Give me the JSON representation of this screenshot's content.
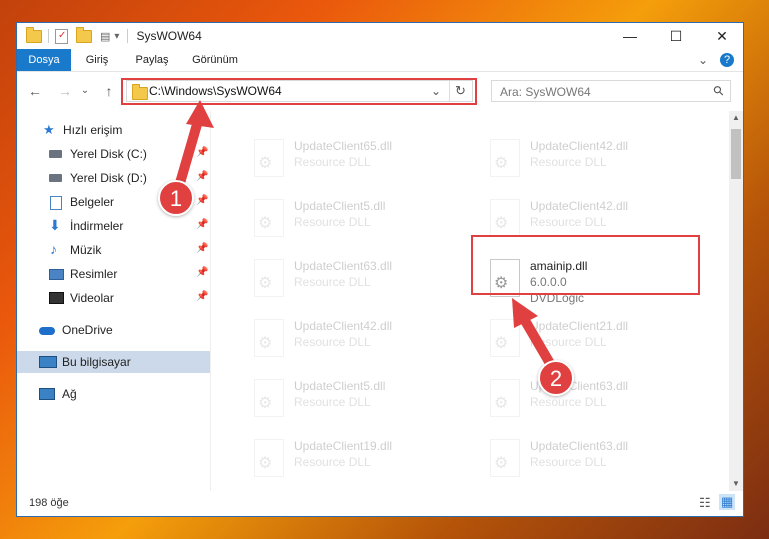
{
  "window": {
    "title": "SysWOW64",
    "qa_chevron": "▾"
  },
  "ribbon": {
    "tabs": [
      {
        "label": "Dosya",
        "active": true
      },
      {
        "label": "Giriş",
        "active": false
      },
      {
        "label": "Paylaş",
        "active": false
      },
      {
        "label": "Görünüm",
        "active": false
      }
    ],
    "help": "?"
  },
  "controls": {
    "minimize": "—",
    "maximize": "☐",
    "close": "✕",
    "ribbon_toggle": "⌄"
  },
  "address": {
    "path": "C:\\Windows\\SysWOW64",
    "dropdown": "⌄",
    "refresh": "↻"
  },
  "search": {
    "placeholder": "Ara: SysWOW64",
    "icon": "⚲"
  },
  "nav_buttons": {
    "back": "←",
    "forward": "→",
    "recent": "⌄",
    "up": "↑"
  },
  "sidebar": {
    "items": [
      {
        "label": "Hızlı erişim",
        "pinned": false
      },
      {
        "label": "Yerel Disk (C:)",
        "pinned": true
      },
      {
        "label": "Yerel Disk (D:)",
        "pinned": true
      },
      {
        "label": "Belgeler",
        "pinned": true
      },
      {
        "label": "İndirmeler",
        "pinned": true
      },
      {
        "label": "Müzik",
        "pinned": true
      },
      {
        "label": "Resimler",
        "pinned": true
      },
      {
        "label": "Videolar",
        "pinned": true
      },
      {
        "label": "OneDrive",
        "pinned": false
      },
      {
        "label": "Bu bilgisayar",
        "pinned": false,
        "selected": true
      },
      {
        "label": "Ağ",
        "pinned": false
      }
    ],
    "pin_glyph": "📌"
  },
  "files": [
    {
      "name": "UpdateClient65.dll",
      "desc": "Resource DLL"
    },
    {
      "name": "UpdateClient42.dll",
      "desc": "Resource DLL"
    },
    {
      "name": "UpdateClient5.dll",
      "desc": "Resource DLL"
    },
    {
      "name": "UpdateClient42.dll",
      "desc": "Resource DLL"
    },
    {
      "name": "UpdateClient63.dll",
      "desc": "Resource DLL"
    },
    {
      "name": "amainip.dll",
      "desc": "6.0.0.0",
      "company": "DVDLogic",
      "highlighted": true
    },
    {
      "name": "UpdateClient42.dll",
      "desc": "Resource DLL"
    },
    {
      "name": "UpdateClient21.dll",
      "desc": "Resource DLL"
    },
    {
      "name": "UpdateClient5.dll",
      "desc": "Resource DLL"
    },
    {
      "name": "UpdateClient63.dll",
      "desc": "Resource DLL"
    },
    {
      "name": "UpdateClient19.dll",
      "desc": "Resource DLL"
    },
    {
      "name": "UpdateClient63.dll",
      "desc": "Resource DLL"
    }
  ],
  "status": {
    "count": "198 öğe"
  },
  "scrollbar": {
    "up": "▲",
    "down": "▼"
  },
  "annotations": {
    "step1": "1",
    "step2": "2",
    "color": "#e04040"
  },
  "view_icons": {
    "details": "☷",
    "tiles": "▦"
  }
}
